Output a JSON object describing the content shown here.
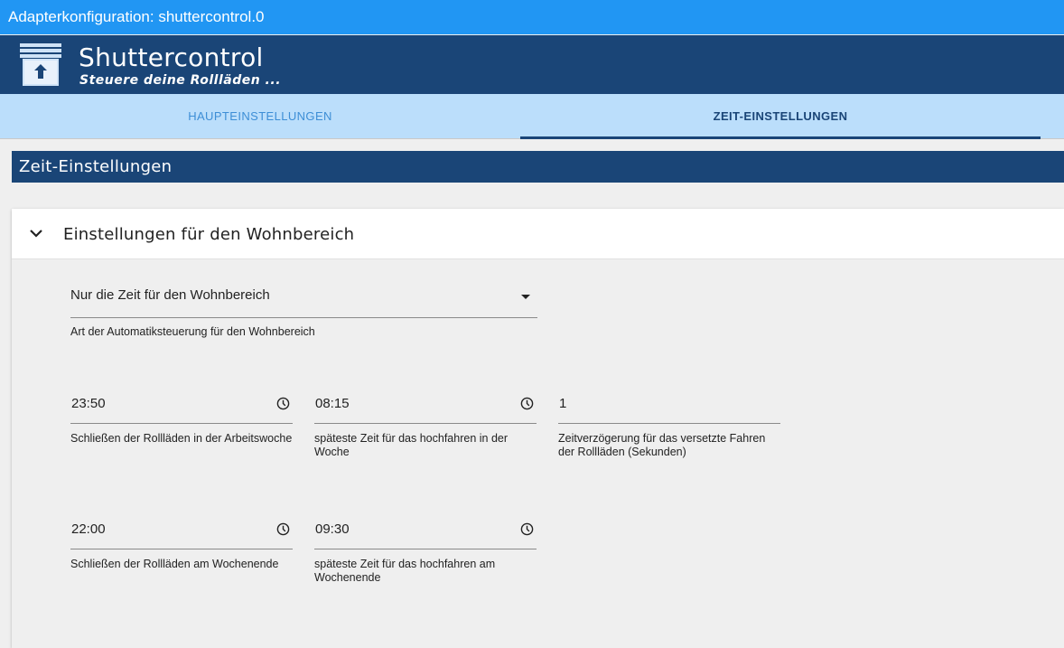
{
  "window": {
    "title": "Adapterkonfiguration: shuttercontrol.0"
  },
  "header": {
    "title": "Shuttercontrol",
    "subtitle": "Steuere deine Rollläden ..."
  },
  "tabs": [
    {
      "label": "HAUPTEINSTELLUNGEN"
    },
    {
      "label": "ZEIT-EINSTELLUNGEN",
      "active": true
    }
  ],
  "section": {
    "title": "Zeit-Einstellungen"
  },
  "panel": {
    "title": "Einstellungen für den Wohnbereich",
    "mode_select": {
      "value": "Nur die Zeit für den Wohnbereich",
      "help": "Art der Automatiksteuerung für den Wohnbereich"
    },
    "fields": [
      {
        "value": "23:50",
        "label": "Schließen der Rollläden in der Arbeitswoche",
        "icon": "clock-icon"
      },
      {
        "value": "08:15",
        "label": "späteste Zeit für das hochfahren in der Woche",
        "icon": "clock-icon"
      },
      {
        "value": "1",
        "label": "Zeitverzögerung für das versetzte Fahren der Rollläden (Sekunden)"
      },
      {
        "value": "22:00",
        "label": "Schließen der Rollläden am Wochenende",
        "icon": "clock-icon"
      },
      {
        "value": "09:30",
        "label": "späteste Zeit für das hochfahren am Wochenende",
        "icon": "clock-icon"
      }
    ]
  },
  "colors": {
    "titlebar": "#2196f3",
    "header": "#1a4577",
    "tabbar": "#bbdefb",
    "inactive_tab": "#3d8ed6"
  }
}
